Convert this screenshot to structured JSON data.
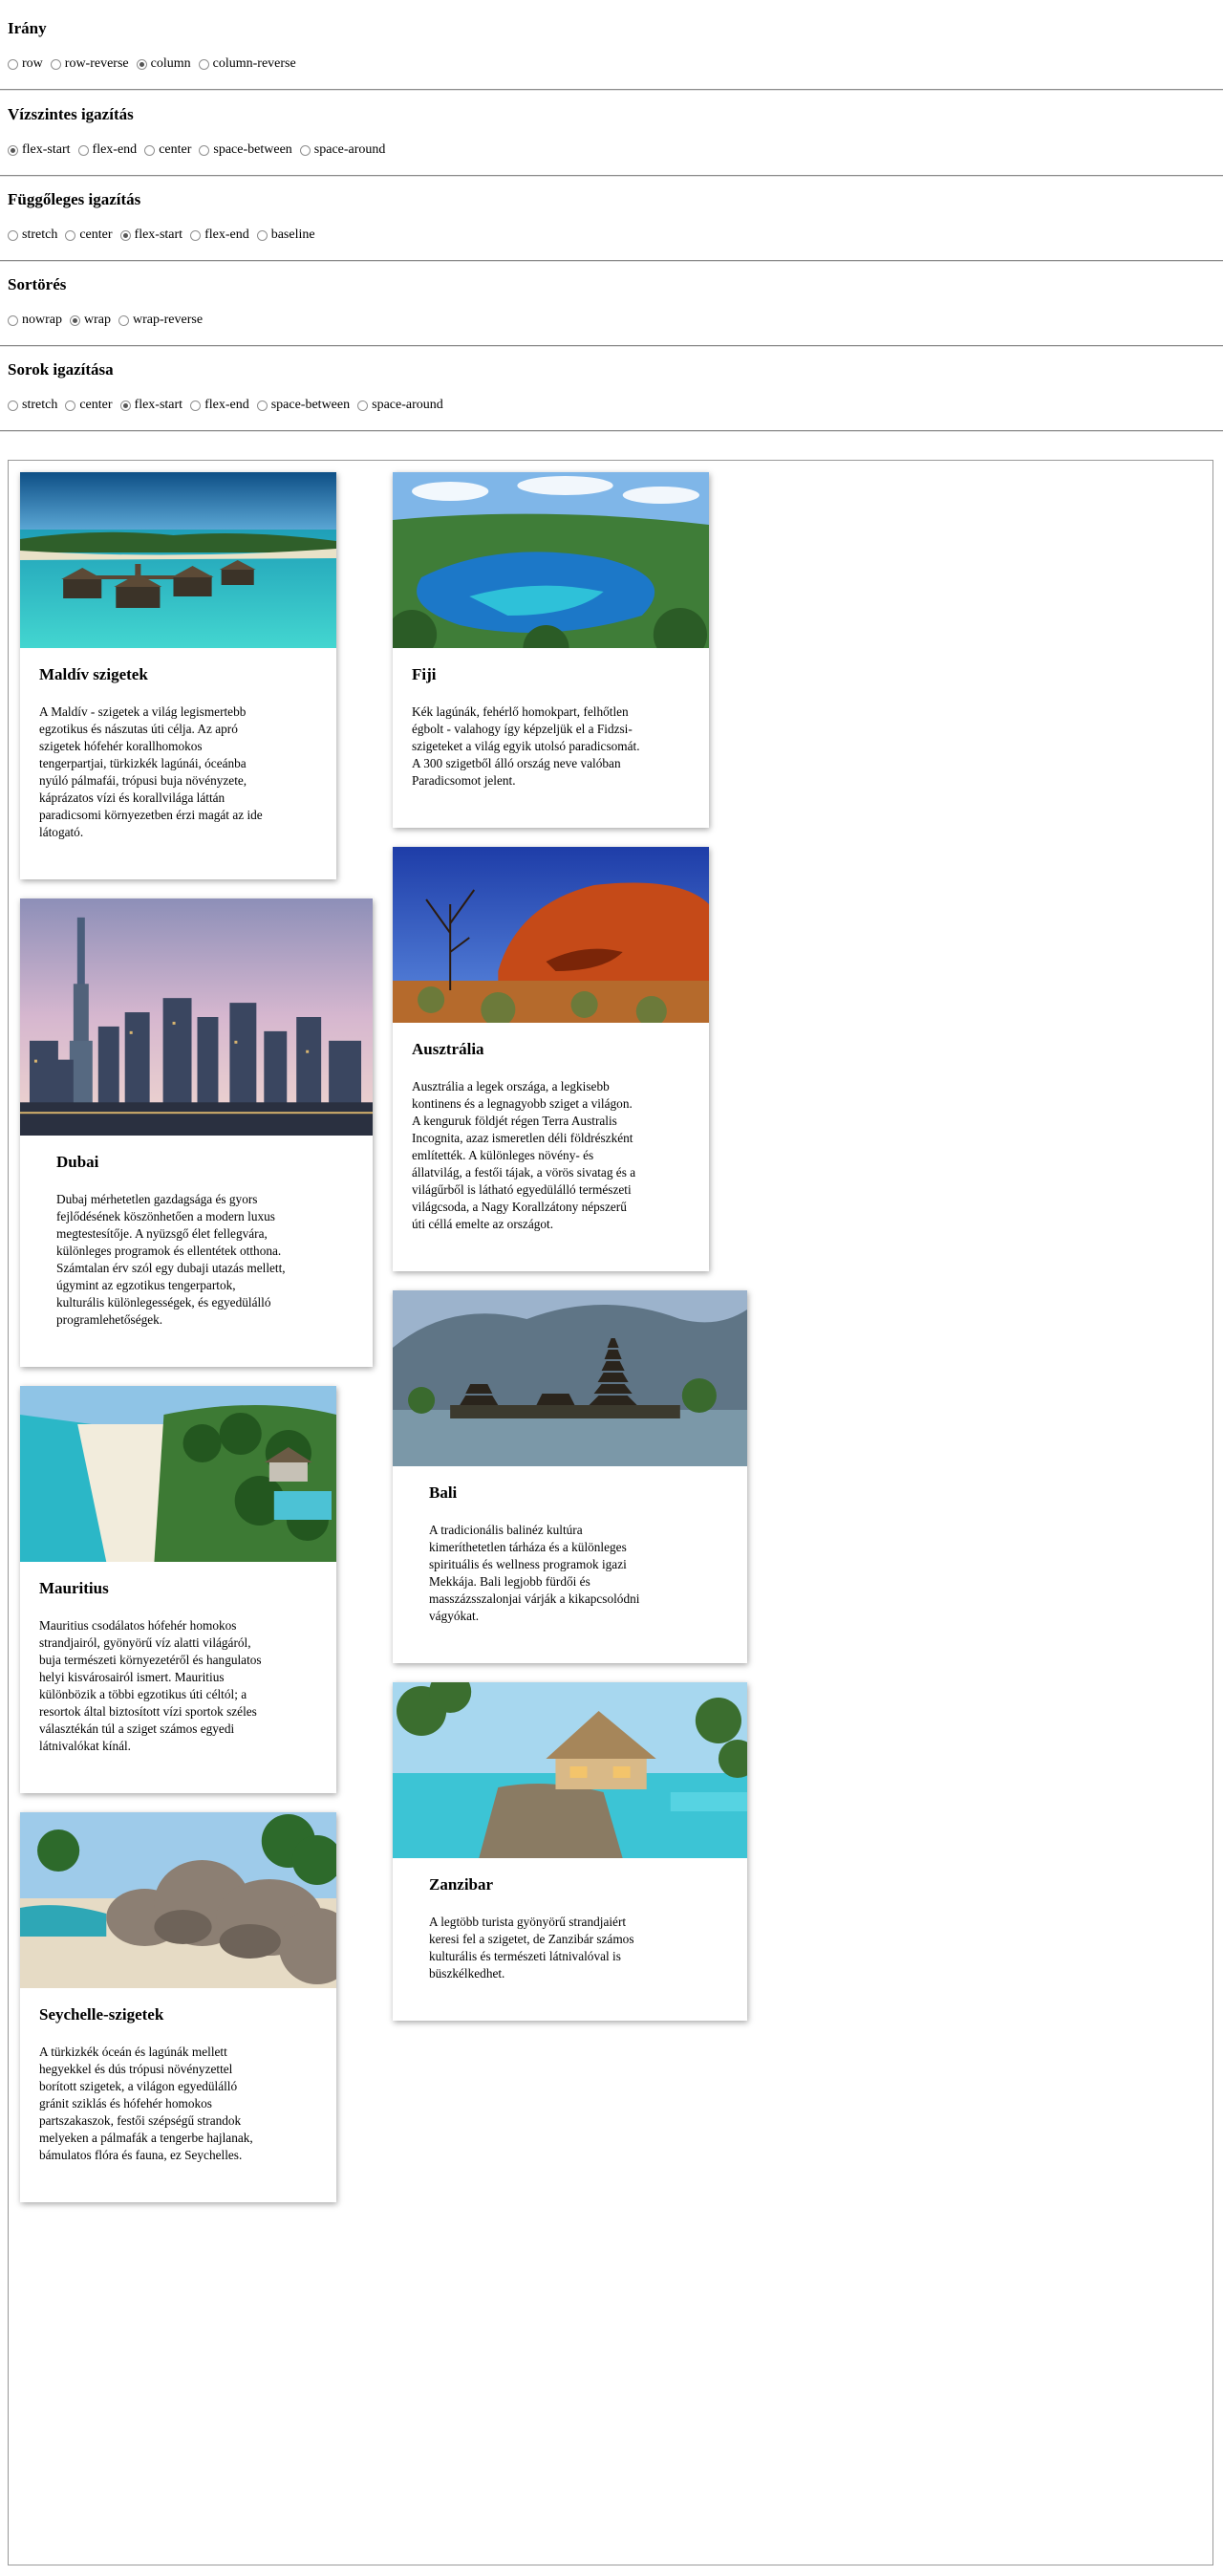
{
  "controls": [
    {
      "title": "Irány",
      "options": [
        {
          "label": "row",
          "checked": false
        },
        {
          "label": "row-reverse",
          "checked": false
        },
        {
          "label": "column",
          "checked": true
        },
        {
          "label": "column-reverse",
          "checked": false
        }
      ]
    },
    {
      "title": "Vízszintes igazítás",
      "options": [
        {
          "label": "flex-start",
          "checked": true
        },
        {
          "label": "flex-end",
          "checked": false
        },
        {
          "label": "center",
          "checked": false
        },
        {
          "label": "space-between",
          "checked": false
        },
        {
          "label": "space-around",
          "checked": false
        }
      ]
    },
    {
      "title": "Függőleges igazítás",
      "options": [
        {
          "label": "stretch",
          "checked": false
        },
        {
          "label": "center",
          "checked": false
        },
        {
          "label": "flex-start",
          "checked": true
        },
        {
          "label": "flex-end",
          "checked": false
        },
        {
          "label": "baseline",
          "checked": false
        }
      ]
    },
    {
      "title": "Sortörés",
      "options": [
        {
          "label": "nowrap",
          "checked": false
        },
        {
          "label": "wrap",
          "checked": true
        },
        {
          "label": "wrap-reverse",
          "checked": false
        }
      ]
    },
    {
      "title": "Sorok igazítása",
      "options": [
        {
          "label": "stretch",
          "checked": false
        },
        {
          "label": "center",
          "checked": false
        },
        {
          "label": "flex-start",
          "checked": true
        },
        {
          "label": "flex-end",
          "checked": false
        },
        {
          "label": "space-between",
          "checked": false
        },
        {
          "label": "space-around",
          "checked": false
        }
      ]
    }
  ],
  "cards": [
    {
      "title": "Maldív szigetek",
      "image": "maldives-resort-photo",
      "lines": [
        "A Maldív - szigetek a világ legismertebb",
        "egzotikus és nászutas úti célja. Az apró",
        "szigetek hófehér korallhomokos",
        "tengerpartjai, türkizkék lagúnái, óceánba",
        "nyúló pálmafái, trópusi buja növényzete,",
        "káprázatos vízi és korallvilága láttán",
        "paradicsomi környezetben érzi magát az ide",
        "látogató."
      ]
    },
    {
      "title": "Dubai",
      "image": "dubai-skyline-photo",
      "lines": [
        "Dubaj mérhetetlen gazdagsága és gyors",
        "fejlődésének köszönhetően a modern luxus",
        "megtestesítője. A nyüzsgő élet fellegvára,",
        "különleges programok és ellentétek otthona.",
        "Számtalan érv szól egy dubaji utazás mellett,",
        "úgymint az egzotikus tengerpartok,",
        "kulturális különlegességek, és egyedülálló",
        "programlehetőségek."
      ]
    },
    {
      "title": "Mauritius",
      "image": "mauritius-beach-photo",
      "lines": [
        "Mauritius csodálatos hófehér homokos",
        "strandjairól, gyönyörű víz alatti világáról,",
        "buja természeti környezetéről és hangulatos",
        "helyi kisvárosairól ismert. Mauritius",
        "különbözik a többi egzotikus úti céltól; a",
        "resortok által biztosított vízi sportok széles",
        "választékán túl a sziget számos egyedi",
        "látnivalókat kínál."
      ]
    },
    {
      "title": "Seychelle-szigetek",
      "image": "seychelles-rocks-photo",
      "lines": [
        "A türkizkék óceán és lagúnák mellett",
        "hegyekkel és dús trópusi növényzettel",
        "borított szigetek, a világon egyedülálló",
        "gránit sziklás és hófehér homokos",
        "partszakaszok, festői szépségű strandok",
        "melyeken a pálmafák a tengerbe hajlanak,",
        "bámulatos flóra és fauna, ez Seychelles."
      ]
    },
    {
      "title": "Fiji",
      "image": "fiji-lagoon-photo",
      "lines": [
        "Kék lagúnák, fehérlő homokpart, felhőtlen",
        "égbolt - valahogy így képzeljük el a Fidzsi-",
        "szigeteket a világ egyik utolsó paradicsomát.",
        "A 300 szigetből álló ország neve valóban",
        "Paradicsomot jelent."
      ]
    },
    {
      "title": "Ausztrália",
      "image": "australia-uluru-photo",
      "lines": [
        "Ausztrália a legek országa, a legkisebb",
        "kontinens és a legnagyobb sziget a világon.",
        "A kenguruk földjét régen Terra Australis",
        "Incognita, azaz ismeretlen déli földrészként",
        "említették. A különleges növény- és",
        "állatvilág, a festői tájak, a vörös sivatag és a",
        "világűrből is látható egyedülálló természeti",
        "világcsoda, a Nagy Korallzátony népszerű",
        "úti céllá emelte az országot."
      ]
    },
    {
      "title": "Bali",
      "image": "bali-temple-photo",
      "lines": [
        "A tradicionális balinéz kultúra",
        "kimeríthetetlen tárháza és a különleges",
        "spirituális és wellness programok igazi",
        "Mekkája. Bali legjobb fürdői és",
        "masszázsszalonjai várják a kikapcsolódni",
        "vágyókat."
      ]
    },
    {
      "title": "Zanzibar",
      "image": "zanzibar-hut-photo",
      "lines": [
        "A legtöbb turista gyönyörű strandjaiért",
        "keresi fel a szigetet, de Zanzibár számos",
        "kulturális és természeti látnivalóval is",
        "büszkélkedhet."
      ]
    }
  ]
}
